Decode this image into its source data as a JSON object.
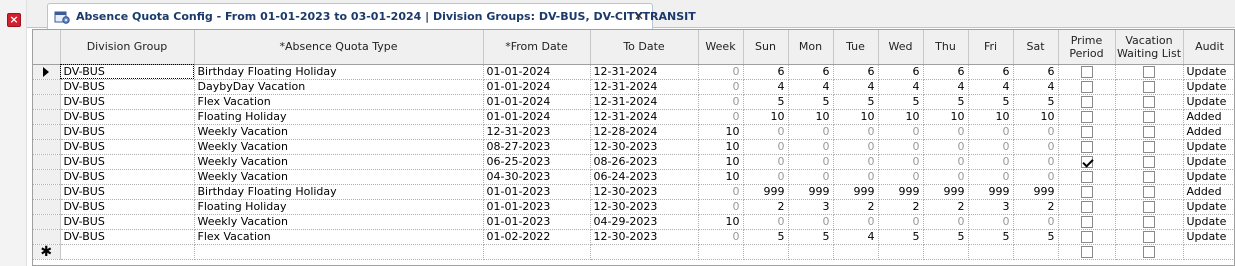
{
  "tab": {
    "title": "Absence Quota Config - From 01-01-2023 to 03-01-2024 | Division Groups: DV-BUS, DV-CITYTRANSIT",
    "close": "✕",
    "icon": "calendar-config-icon"
  },
  "columns": [
    "Division Group",
    "*Absence Quota Type",
    "*From Date",
    "To Date",
    "Week",
    "Sun",
    "Mon",
    "Tue",
    "Wed",
    "Thu",
    "Fri",
    "Sat",
    "Prime Period",
    "Vacation Waiting List",
    "Audit"
  ],
  "rows": [
    {
      "group": "DV-BUS",
      "type": "Birthday Floating Holiday",
      "from": "01-01-2024",
      "to": "12-31-2024",
      "week": "0",
      "sun": "6",
      "mon": "6",
      "tue": "6",
      "wed": "6",
      "thu": "6",
      "fri": "6",
      "sat": "6",
      "prime": false,
      "waiting": false,
      "audit": "Update"
    },
    {
      "group": "DV-BUS",
      "type": "DaybyDay Vacation",
      "from": "01-01-2024",
      "to": "12-31-2024",
      "week": "0",
      "sun": "4",
      "mon": "4",
      "tue": "4",
      "wed": "4",
      "thu": "4",
      "fri": "4",
      "sat": "4",
      "prime": false,
      "waiting": false,
      "audit": "Update"
    },
    {
      "group": "DV-BUS",
      "type": "Flex Vacation",
      "from": "01-01-2024",
      "to": "12-31-2024",
      "week": "0",
      "sun": "5",
      "mon": "5",
      "tue": "5",
      "wed": "5",
      "thu": "5",
      "fri": "5",
      "sat": "5",
      "prime": false,
      "waiting": false,
      "audit": "Update"
    },
    {
      "group": "DV-BUS",
      "type": "Floating Holiday",
      "from": "01-01-2024",
      "to": "12-31-2024",
      "week": "0",
      "sun": "10",
      "mon": "10",
      "tue": "10",
      "wed": "10",
      "thu": "10",
      "fri": "10",
      "sat": "10",
      "prime": false,
      "waiting": false,
      "audit": "Added"
    },
    {
      "group": "DV-BUS",
      "type": "Weekly Vacation",
      "from": "12-31-2023",
      "to": "12-28-2024",
      "week": "10",
      "sun": "0",
      "mon": "0",
      "tue": "0",
      "wed": "0",
      "thu": "0",
      "fri": "0",
      "sat": "0",
      "prime": false,
      "waiting": false,
      "audit": "Added"
    },
    {
      "group": "DV-BUS",
      "type": "Weekly Vacation",
      "from": "08-27-2023",
      "to": "12-30-2023",
      "week": "10",
      "sun": "0",
      "mon": "0",
      "tue": "0",
      "wed": "0",
      "thu": "0",
      "fri": "0",
      "sat": "0",
      "prime": false,
      "waiting": false,
      "audit": "Update"
    },
    {
      "group": "DV-BUS",
      "type": "Weekly Vacation",
      "from": "06-25-2023",
      "to": "08-26-2023",
      "week": "10",
      "sun": "0",
      "mon": "0",
      "tue": "0",
      "wed": "0",
      "thu": "0",
      "fri": "0",
      "sat": "0",
      "prime": true,
      "waiting": false,
      "audit": "Update"
    },
    {
      "group": "DV-BUS",
      "type": "Weekly Vacation",
      "from": "04-30-2023",
      "to": "06-24-2023",
      "week": "10",
      "sun": "0",
      "mon": "0",
      "tue": "0",
      "wed": "0",
      "thu": "0",
      "fri": "0",
      "sat": "0",
      "prime": false,
      "waiting": false,
      "audit": "Update"
    },
    {
      "group": "DV-BUS",
      "type": "Birthday Floating Holiday",
      "from": "01-01-2023",
      "to": "12-30-2023",
      "week": "0",
      "sun": "999",
      "mon": "999",
      "tue": "999",
      "wed": "999",
      "thu": "999",
      "fri": "999",
      "sat": "999",
      "prime": false,
      "waiting": false,
      "audit": "Added"
    },
    {
      "group": "DV-BUS",
      "type": "Floating Holiday",
      "from": "01-01-2023",
      "to": "12-30-2023",
      "week": "0",
      "sun": "2",
      "mon": "3",
      "tue": "2",
      "wed": "2",
      "thu": "2",
      "fri": "3",
      "sat": "2",
      "prime": false,
      "waiting": false,
      "audit": "Update"
    },
    {
      "group": "DV-BUS",
      "type": "Weekly Vacation",
      "from": "01-01-2023",
      "to": "04-29-2023",
      "week": "10",
      "sun": "0",
      "mon": "0",
      "tue": "0",
      "wed": "0",
      "thu": "0",
      "fri": "0",
      "sat": "0",
      "prime": false,
      "waiting": false,
      "audit": "Update"
    },
    {
      "group": "DV-BUS",
      "type": "Flex Vacation",
      "from": "01-02-2022",
      "to": "12-30-2023",
      "week": "0",
      "sun": "5",
      "mon": "5",
      "tue": "4",
      "wed": "5",
      "thu": "5",
      "fri": "5",
      "sat": "5",
      "prime": false,
      "waiting": false,
      "audit": "Update"
    }
  ],
  "new_row_marker": "✱",
  "colors": {
    "accent": "#1b3a6b",
    "close_red": "#d32030",
    "zero_gray": "#9a9a9a"
  }
}
